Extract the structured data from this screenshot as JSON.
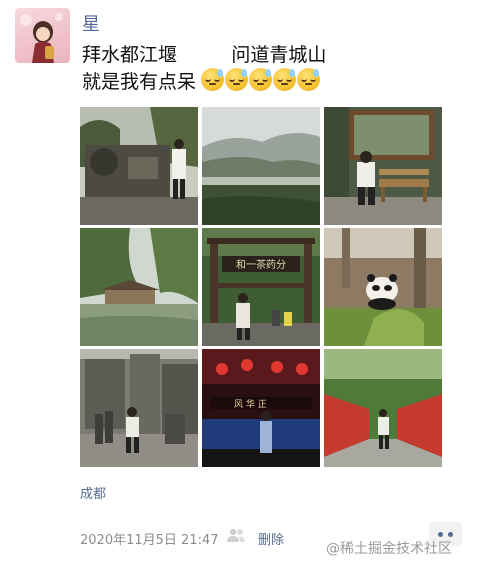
{
  "post": {
    "author": "星",
    "line1": "拜水都江堰         问道青城山",
    "line2": "就是我有点呆",
    "emoji_count": 5,
    "emoji_icon": "sweat-smile-emoji",
    "location": "成都",
    "timestamp": "2020年11月5日 21:47",
    "delete_label": "删除"
  },
  "photos": [
    {
      "id": "photo-dujiangyan-stone-sign"
    },
    {
      "id": "photo-valley-river-view"
    },
    {
      "id": "photo-bench-wooden-frame"
    },
    {
      "id": "photo-pond-pavilion"
    },
    {
      "id": "photo-wooden-gate-plaque"
    },
    {
      "id": "photo-panda"
    },
    {
      "id": "photo-stone-ruins"
    },
    {
      "id": "photo-stage-red-lanterns"
    },
    {
      "id": "photo-red-wall-corridor"
    }
  ],
  "gate_plaque_text": "和一茶药分",
  "stage_sign_text": "风 华 正",
  "watermark": "@稀土掘金技术社区",
  "colors": {
    "link_blue": "#576b95",
    "meta_gray": "#8c8c8c",
    "text_black": "#111111"
  }
}
